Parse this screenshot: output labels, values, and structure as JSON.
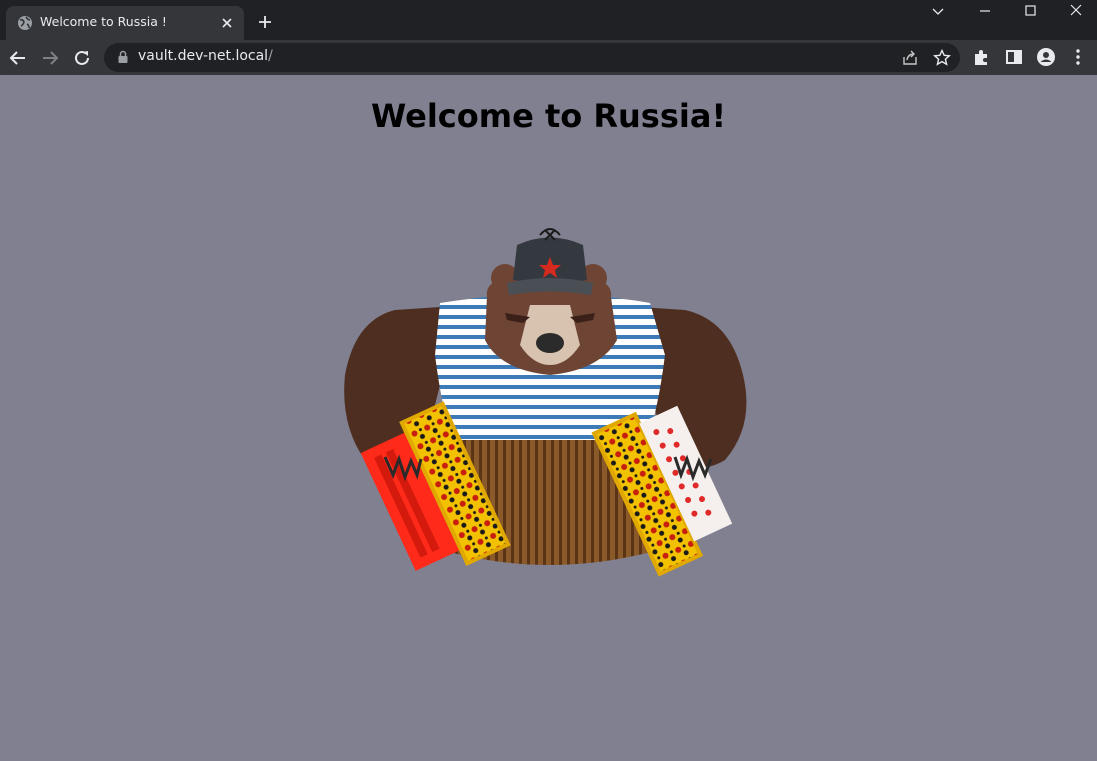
{
  "browser": {
    "tab_title": "Welcome to Russia !",
    "url_host": "vault.dev-net.local",
    "url_path": "/"
  },
  "page": {
    "heading": "Welcome to Russia!",
    "image_icon": "bear-with-accordion-illustration"
  },
  "colors": {
    "page_background": "#808090",
    "browser_frame": "#202124",
    "toolbar": "#35363a"
  }
}
